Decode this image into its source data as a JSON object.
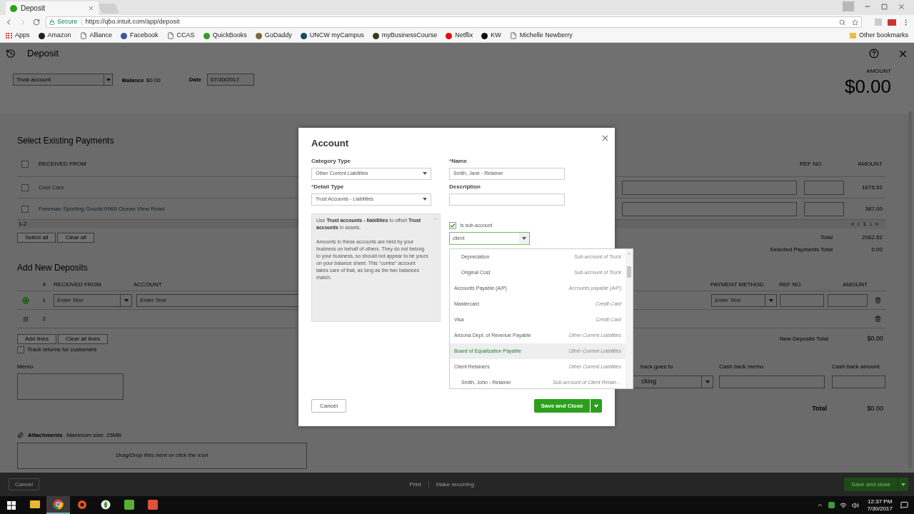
{
  "browser": {
    "tab_title": "Deposit",
    "secure_label": "Secure",
    "url": "https://qbo.intuit.com/app/deposit",
    "bookmarks": [
      {
        "label": "Apps",
        "kind": "apps"
      },
      {
        "label": "Amazon",
        "kind": "site",
        "color": "#222222"
      },
      {
        "label": "Alliance",
        "kind": "page"
      },
      {
        "label": "Facebook",
        "kind": "site",
        "color": "#3b5998"
      },
      {
        "label": "CCAS",
        "kind": "page"
      },
      {
        "label": "QuickBooks",
        "kind": "site",
        "color": "#2ca01c"
      },
      {
        "label": "GoDaddy",
        "kind": "site",
        "color": "#7a6a3a"
      },
      {
        "label": "UNCW myCampus",
        "kind": "site",
        "color": "#1a4a5a"
      },
      {
        "label": "myBusinessCourse",
        "kind": "site",
        "color": "#3a3a1a"
      },
      {
        "label": "Netflix",
        "kind": "site",
        "color": "#e50914"
      },
      {
        "label": "KW",
        "kind": "site",
        "color": "#111111"
      },
      {
        "label": "Michelle Newberry",
        "kind": "page"
      }
    ],
    "other_bookmarks": "Other bookmarks"
  },
  "deposit": {
    "title": "Deposit",
    "account_select": "Trust account",
    "balance_label": "Balance",
    "balance_value": "$0.00",
    "date_label": "Date",
    "date_value": "07/30/2017",
    "amount_label": "AMOUNT",
    "amount_value": "$0.00"
  },
  "existing_payments": {
    "heading": "Select Existing Payments",
    "select_all_checked": false,
    "columns": [
      "RECEIVED FROM",
      "REF NO.",
      "AMOUNT"
    ],
    "rows": [
      {
        "received_from": "Cool Cars",
        "amount": "1675.52",
        "checked": false
      },
      {
        "received_from": "Freeman Sporting Goods:0969 Ocean View Road",
        "amount": "387.00",
        "checked": false
      }
    ],
    "range": "1-2",
    "page": "1",
    "buttons": [
      "Select all",
      "Clear all"
    ],
    "totals": [
      {
        "label": "Total",
        "value": "2062.52"
      },
      {
        "label": "Selected Payments Total",
        "value": "0.00"
      }
    ]
  },
  "new_deposits": {
    "heading": "Add New Deposits",
    "columns": [
      "#",
      "RECEIVED FROM",
      "ACCOUNT",
      "PAYMENT METHOD",
      "REF NO.",
      "AMOUNT"
    ],
    "rows": [
      {
        "number": "1",
        "active": true,
        "received_from_placeholder": "Enter Text",
        "account_placeholder": "Enter Text",
        "payment_method_placeholder": "Enter Text"
      },
      {
        "number": "2",
        "active": false
      }
    ],
    "buttons": [
      "Add lines",
      "Clear all lines"
    ],
    "total_label": "New Deposits Total",
    "total_value": "$0.00",
    "track_returns": {
      "label": "Track returns for customers",
      "checked": false
    },
    "memo_label": "Memo",
    "cash_back_goes_to_label": "back goes to",
    "cash_back_account": "cking",
    "cash_back_memo_label": "Cash back memo",
    "cash_back_amount_label": "Cash back amount",
    "grand_total_label": "Total",
    "grand_total_value": "$0.00"
  },
  "attachments": {
    "label": "Attachments",
    "max_size": "Maximum size: 25MB",
    "drop_hint": "Drag/Drop files here or click the icon"
  },
  "footer": {
    "cancel": "Cancel",
    "print": "Print",
    "make_recurring": "Make recurring",
    "save": "Save and close"
  },
  "modal": {
    "title": "Account",
    "required_mark": "*",
    "category_type_label": "Category Type",
    "category_type": "Other Current Liabilities",
    "detail_type_label": "Detail Type",
    "detail_type": "Trust Accounts - Liabilities",
    "detail_description": [
      "Use **Trust accounts - liabilities** to offset **Trust accounts** in assets.",
      "Amounts in these accounts are held by your business on behalf of others. They do not belong to your business, so should not appear to be yours on your balance sheet. This \"contra\" account takes care of that, as long as the two balances match."
    ],
    "name_label": "Name",
    "name_value": "Smith, Jane - Retainer",
    "description_label": "Description",
    "is_sub_account": {
      "label": "Is sub-account",
      "checked": true
    },
    "parent_query": "client",
    "parent_options": [
      {
        "name": "Depreciation",
        "type": "Sub-account of Truck",
        "kind": "sub",
        "selected": false
      },
      {
        "name": "Original Cost",
        "type": "Sub-account of Truck",
        "kind": "sub",
        "selected": false
      },
      {
        "name": "Accounts Payable (A/P)",
        "type": "Accounts payable (A/P)",
        "kind": "account",
        "selected": false
      },
      {
        "name": "Mastercard",
        "type": "Credit Card",
        "kind": "account",
        "selected": false
      },
      {
        "name": "Visa",
        "type": "Credit Card",
        "kind": "account",
        "selected": false
      },
      {
        "name": "Arizona Dept. of Revenue Payable",
        "type": "Other Current Liabilities",
        "kind": "account",
        "selected": false
      },
      {
        "name": "Board of Equalization Payable",
        "type": "Other Current Liabilities",
        "kind": "account",
        "selected": true
      },
      {
        "name": "Client Retainers",
        "type": "Other Current Liabilities",
        "kind": "account",
        "selected": false
      },
      {
        "name": "Smith, John - Retainer",
        "type": "Sub-account of Client Retain…",
        "kind": "sub",
        "selected": false
      }
    ],
    "cancel": "Cancel",
    "save": "Save and Close"
  },
  "taskbar": {
    "apps": [
      {
        "kind": "explorer",
        "selected": false
      },
      {
        "kind": "chrome",
        "selected": true
      },
      {
        "kind": "orange",
        "selected": false
      },
      {
        "kind": "leaf",
        "selected": false
      },
      {
        "kind": "green",
        "selected": false
      },
      {
        "kind": "red",
        "selected": false
      }
    ],
    "time": "12:37 PM",
    "date": "7/30/2017"
  }
}
